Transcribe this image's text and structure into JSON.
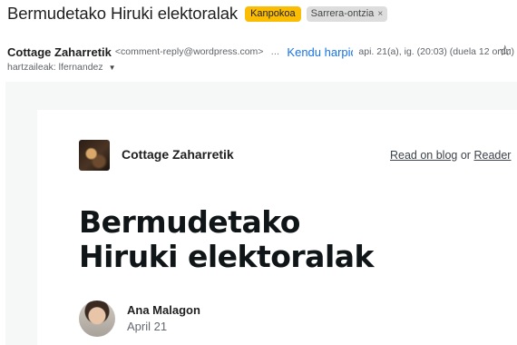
{
  "email": {
    "subject": "Bermudetako Hiruki elektoralak",
    "labels": {
      "external": "Kanpokoa",
      "inbox": "Sarrera-ontzia",
      "remove": "×"
    },
    "sender_name": "Cottage Zaharretik",
    "sender_email": "<comment-reply@wordpress.com>",
    "separator": "…",
    "unsubscribe": "Kendu harpidetza",
    "date": "api. 21(a), ig. (20:03) (duela 12 ordu)",
    "star": "☆",
    "to": "hartzaileak: lfernandez",
    "to_caret": "▼"
  },
  "post": {
    "blog_name": "Cottage Zaharretik",
    "read_on_blog": "Read on blog",
    "or": "or",
    "reader": "Reader",
    "title_line1": "Bermudetako",
    "title_line2": "Hiruki elektoralak",
    "author": "Ana Malagon",
    "date": "April 21"
  },
  "colors": {
    "external_label": "#fbbc04",
    "link": "#1a73e8"
  }
}
